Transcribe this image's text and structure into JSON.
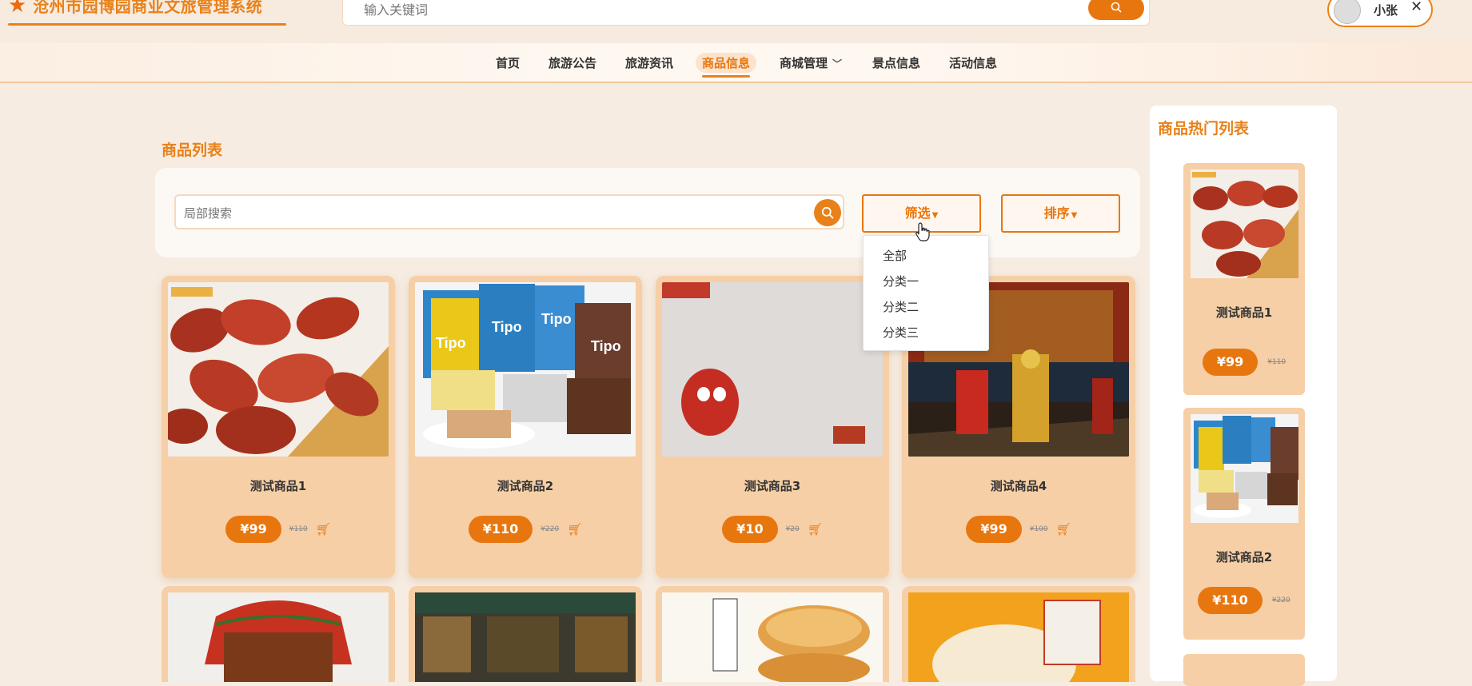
{
  "header": {
    "title": "沧州市园博园商业文旅管理系统",
    "search_placeholder": "输入关键词",
    "username": "小张"
  },
  "nav": {
    "items": [
      "首页",
      "旅游公告",
      "旅游资讯",
      "商品信息",
      "商城管理",
      "景点信息",
      "活动信息"
    ],
    "active": "商品信息"
  },
  "main": {
    "section_title": "商品列表",
    "local_search_placeholder": "局部搜索",
    "filter_label": "筛选",
    "sort_label": "排序",
    "filter_options": [
      "全部",
      "分类一",
      "分类二",
      "分类三"
    ]
  },
  "products": [
    {
      "name": "测试商品1",
      "price": "¥99",
      "old_price": "¥110"
    },
    {
      "name": "测试商品2",
      "price": "¥110",
      "old_price": "¥220"
    },
    {
      "name": "测试商品3",
      "price": "¥10",
      "old_price": "¥20"
    },
    {
      "name": "测试商品4",
      "price": "¥99",
      "old_price": "¥100"
    }
  ],
  "hot": {
    "title": "商品热门列表",
    "items": [
      {
        "name": "测试商品1",
        "price": "¥99",
        "old_price": "¥110"
      },
      {
        "name": "测试商品2",
        "price": "¥110",
        "old_price": "¥220"
      }
    ]
  },
  "colors": {
    "accent": "#e8760f",
    "card": "#f6cfa6",
    "background": "#f6ece2"
  }
}
